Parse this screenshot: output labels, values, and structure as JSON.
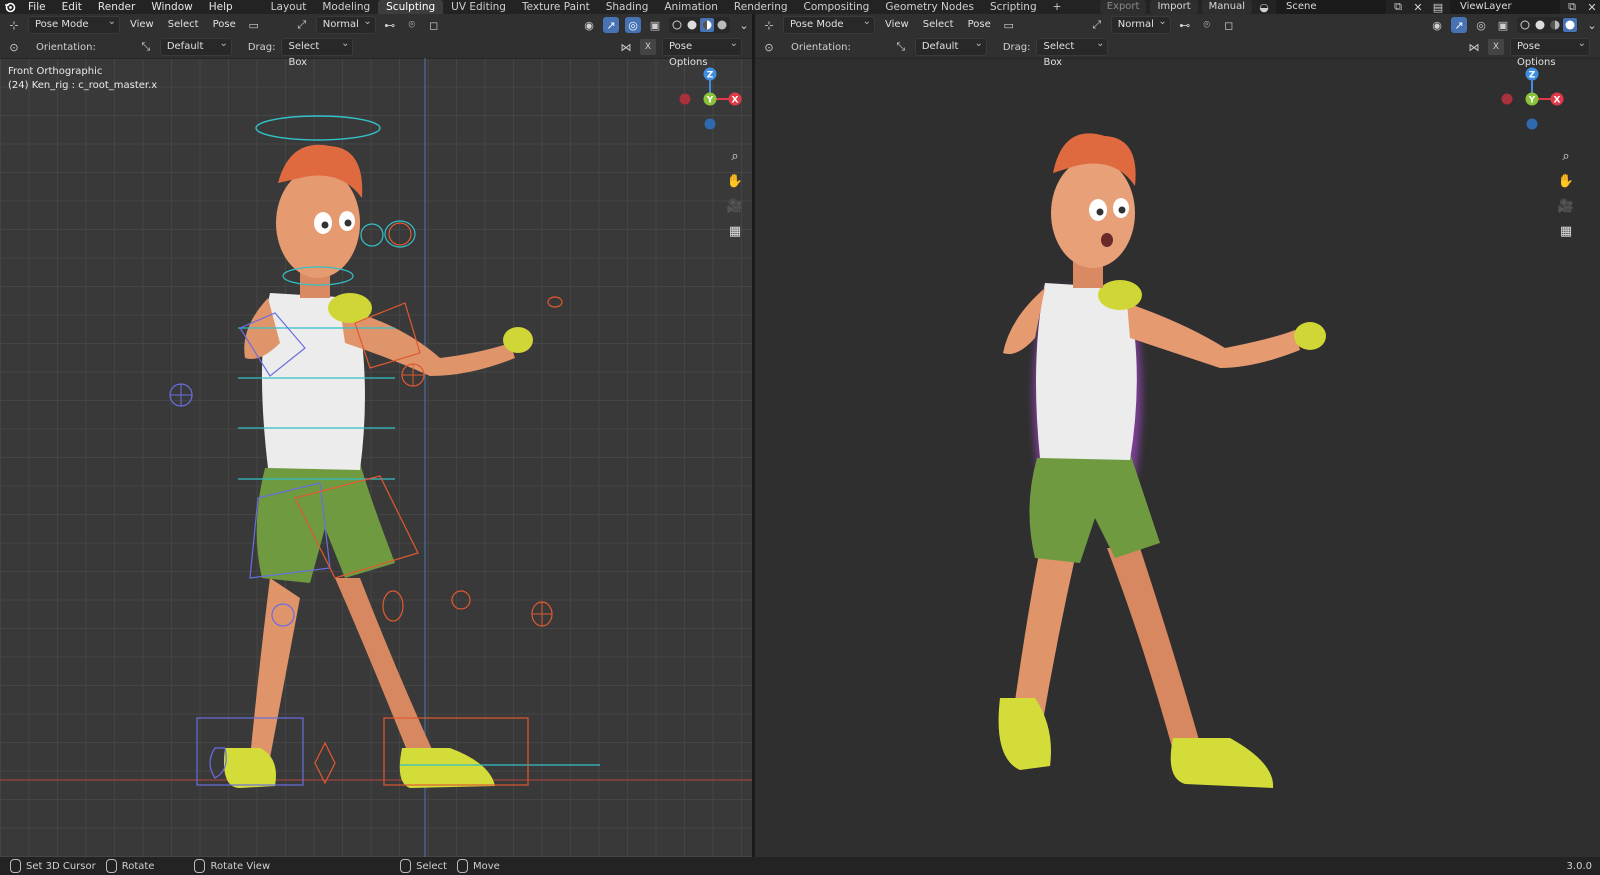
{
  "menu": {
    "items": [
      "File",
      "Edit",
      "Render",
      "Window",
      "Help"
    ]
  },
  "workspaces": [
    {
      "label": "Layout",
      "active": false
    },
    {
      "label": "Modeling",
      "active": false
    },
    {
      "label": "Sculpting",
      "active": true
    },
    {
      "label": "UV Editing",
      "active": false
    },
    {
      "label": "Texture Paint",
      "active": false
    },
    {
      "label": "Shading",
      "active": false
    },
    {
      "label": "Animation",
      "active": false
    },
    {
      "label": "Rendering",
      "active": false
    },
    {
      "label": "Compositing",
      "active": false
    },
    {
      "label": "Geometry Nodes",
      "active": false
    },
    {
      "label": "Scripting",
      "active": false
    }
  ],
  "topright": {
    "export_label": "Export",
    "import_label": "Import",
    "manual_label": "Manual",
    "scene": "Scene",
    "view_layer": "ViewLayer"
  },
  "viewport_left": {
    "mode": "Pose Mode",
    "menu": [
      "View",
      "Select",
      "Pose"
    ],
    "transform_orientation": "Normal",
    "orientation_label": "Orientation:",
    "orientation_value": "Default",
    "drag_label": "Drag:",
    "drag_value": "Select Box",
    "pose_options": "Pose Options",
    "view_name": "Front Orthographic",
    "active_object": "(24) Ken_rig : c_root_master.x"
  },
  "viewport_right": {
    "mode": "Pose Mode",
    "menu": [
      "View",
      "Select",
      "Pose"
    ],
    "transform_orientation": "Normal",
    "orientation_label": "Orientation:",
    "orientation_value": "Default",
    "drag_label": "Drag:",
    "drag_value": "Select Box",
    "pose_options": "Pose Options"
  },
  "gizmo": {
    "z": "Z",
    "y": "Y",
    "x": "X"
  },
  "statusbar": {
    "items": [
      "Set 3D Cursor",
      "Rotate",
      "Rotate View",
      "Select",
      "Move"
    ],
    "version": "3.0.0"
  },
  "colors": {
    "accent": "#4772b3",
    "axis_x": "#e03a4a",
    "axis_y": "#8ac33a",
    "axis_z": "#3f8fe0",
    "skin": "#e0946a",
    "hair": "#e06a40",
    "shirt": "#e8e8e8",
    "shorts": "#6f9a40",
    "shoes": "#d4dc3a"
  }
}
